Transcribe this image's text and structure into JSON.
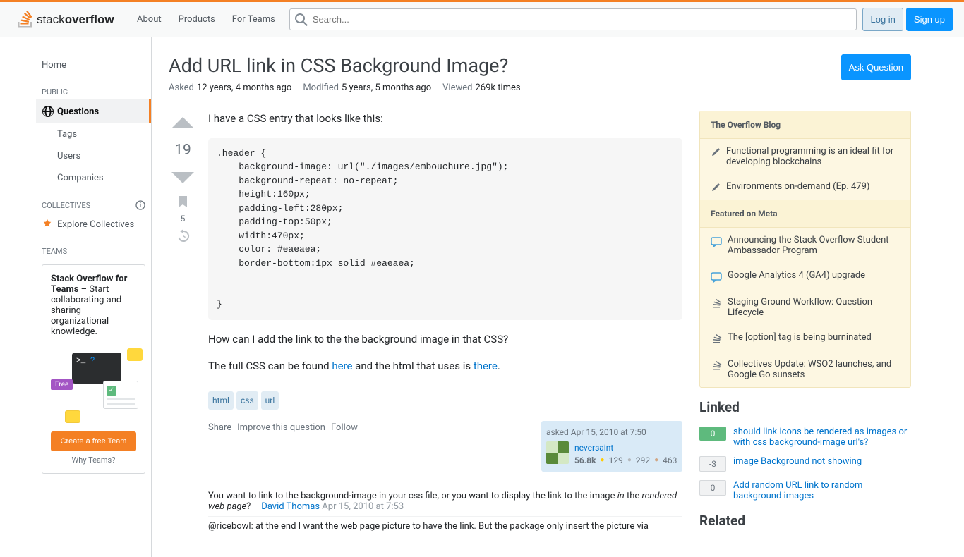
{
  "header": {
    "nav": {
      "about": "About",
      "products": "Products",
      "for_teams": "For Teams"
    },
    "search_placeholder": "Search...",
    "login": "Log in",
    "signup": "Sign up"
  },
  "sidebar": {
    "home": "Home",
    "public_label": "PUBLIC",
    "questions": "Questions",
    "tags": "Tags",
    "users": "Users",
    "companies": "Companies",
    "collectives_label": "COLLECTIVES",
    "explore_collectives": "Explore Collectives",
    "teams_label": "TEAMS",
    "teams_title": "Stack Overflow for Teams",
    "teams_desc": " – Start collaborating and sharing organizational knowledge.",
    "free_badge": "Free",
    "create_team": "Create a free Team",
    "why_teams": "Why Teams?"
  },
  "question": {
    "title": "Add URL link in CSS Background Image?",
    "ask_button": "Ask Question",
    "meta": {
      "asked_label": "Asked",
      "asked_value": "12 years, 4 months ago",
      "modified_label": "Modified",
      "modified_value": "5 years, 5 months ago",
      "viewed_label": "Viewed",
      "viewed_value": "269k times"
    },
    "score": "19",
    "bookmark_count": "5",
    "body_intro": "I have a CSS entry that looks like this:",
    "code": ".header {\n    background-image: url(\"./images/embouchure.jpg\");\n    background-repeat: no-repeat;\n    height:160px;\n    padding-left:280px;\n    padding-top:50px;\n    width:470px;\n    color: #eaeaea;\n    border-bottom:1px solid #eaeaea;\n\n\n}",
    "body_q": "How can I add the link to the the background image in that CSS?",
    "body_full_pre": "The full CSS can be found ",
    "body_full_here": "here",
    "body_full_mid": " and the html that uses is ",
    "body_full_there": "there",
    "tags": [
      "html",
      "css",
      "url"
    ],
    "actions": {
      "share": "Share",
      "improve": "Improve this question",
      "follow": "Follow"
    },
    "user_card": {
      "asked": "asked Apr 15, 2010 at 7:50",
      "name": "neversaint",
      "rep": "56.8k",
      "gold": "129",
      "silver": "292",
      "bronze": "463"
    },
    "comments": [
      {
        "text_pre": "You want to link to the background-image in your css file, or you want to display the link to the image ",
        "text_em": "in",
        "text_post": " the ",
        "text_em2": "rendered web page",
        "text_end": "? – ",
        "user": "David Thomas",
        "date": "Apr 15, 2010 at 7:53"
      },
      {
        "text_pre": "@ricebowl: at the end I want the web page picture to have the link. But the package only insert the picture via",
        "user": "",
        "date": ""
      }
    ]
  },
  "right": {
    "overflow_blog": "The Overflow Blog",
    "blog_items": [
      "Functional programming is an ideal fit for developing blockchains",
      "Environments on-demand (Ep. 479)"
    ],
    "featured_meta": "Featured on Meta",
    "meta_items": [
      {
        "icon": "speech",
        "text": "Announcing the Stack Overflow Student Ambassador Program"
      },
      {
        "icon": "speech",
        "text": "Google Analytics 4 (GA4) upgrade"
      },
      {
        "icon": "stack",
        "text": "Staging Ground Workflow: Question Lifecycle"
      },
      {
        "icon": "stack",
        "text": "The [option] tag is being burninated"
      },
      {
        "icon": "stack",
        "text": "Collectives Update: WSO2 launches, and Google Go sunsets"
      }
    ],
    "linked_title": "Linked",
    "linked": [
      {
        "score": "0",
        "accepted": true,
        "title": "should link icons be rendered as images or with css background-image url's?"
      },
      {
        "score": "-3",
        "accepted": false,
        "title": "image Background not showing"
      },
      {
        "score": "0",
        "accepted": false,
        "title": "Add random URL link to random background images"
      }
    ],
    "related_title": "Related"
  }
}
